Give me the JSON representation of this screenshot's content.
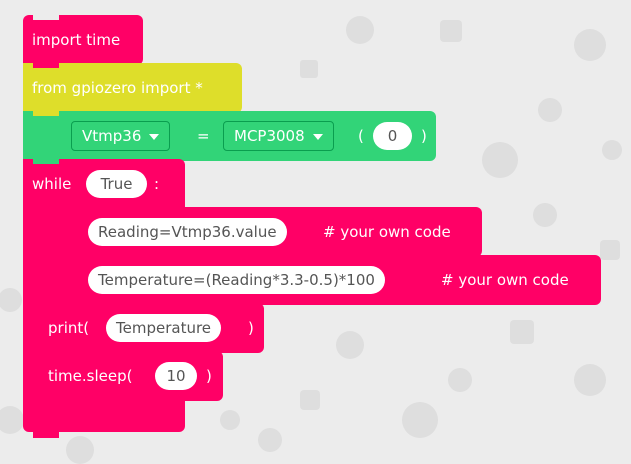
{
  "colors": {
    "pink": "#ff0066",
    "yellow": "#dede2a",
    "green": "#32d478",
    "background": "#ececec"
  },
  "blocks": {
    "import_time": {
      "text": "import time"
    },
    "from_import": {
      "text": "from gpiozero import *"
    },
    "assign": {
      "variable": "Vtmp36",
      "equals": "=",
      "class_name": "MCP3008",
      "open_paren": "(",
      "arg": "0",
      "close_paren": ")"
    },
    "while": {
      "keyword": "while",
      "condition": "True",
      "colon": ":"
    },
    "reading": {
      "code": "Reading=Vtmp36.value",
      "comment": "# your own code"
    },
    "temperature": {
      "code": "Temperature=(Reading*3.3-0.5)*100",
      "comment": "# your own code"
    },
    "print": {
      "keyword": "print(",
      "arg": "Temperature",
      "close": ")"
    },
    "sleep": {
      "keyword": "time.sleep(",
      "arg": "10",
      "close": ")"
    }
  }
}
